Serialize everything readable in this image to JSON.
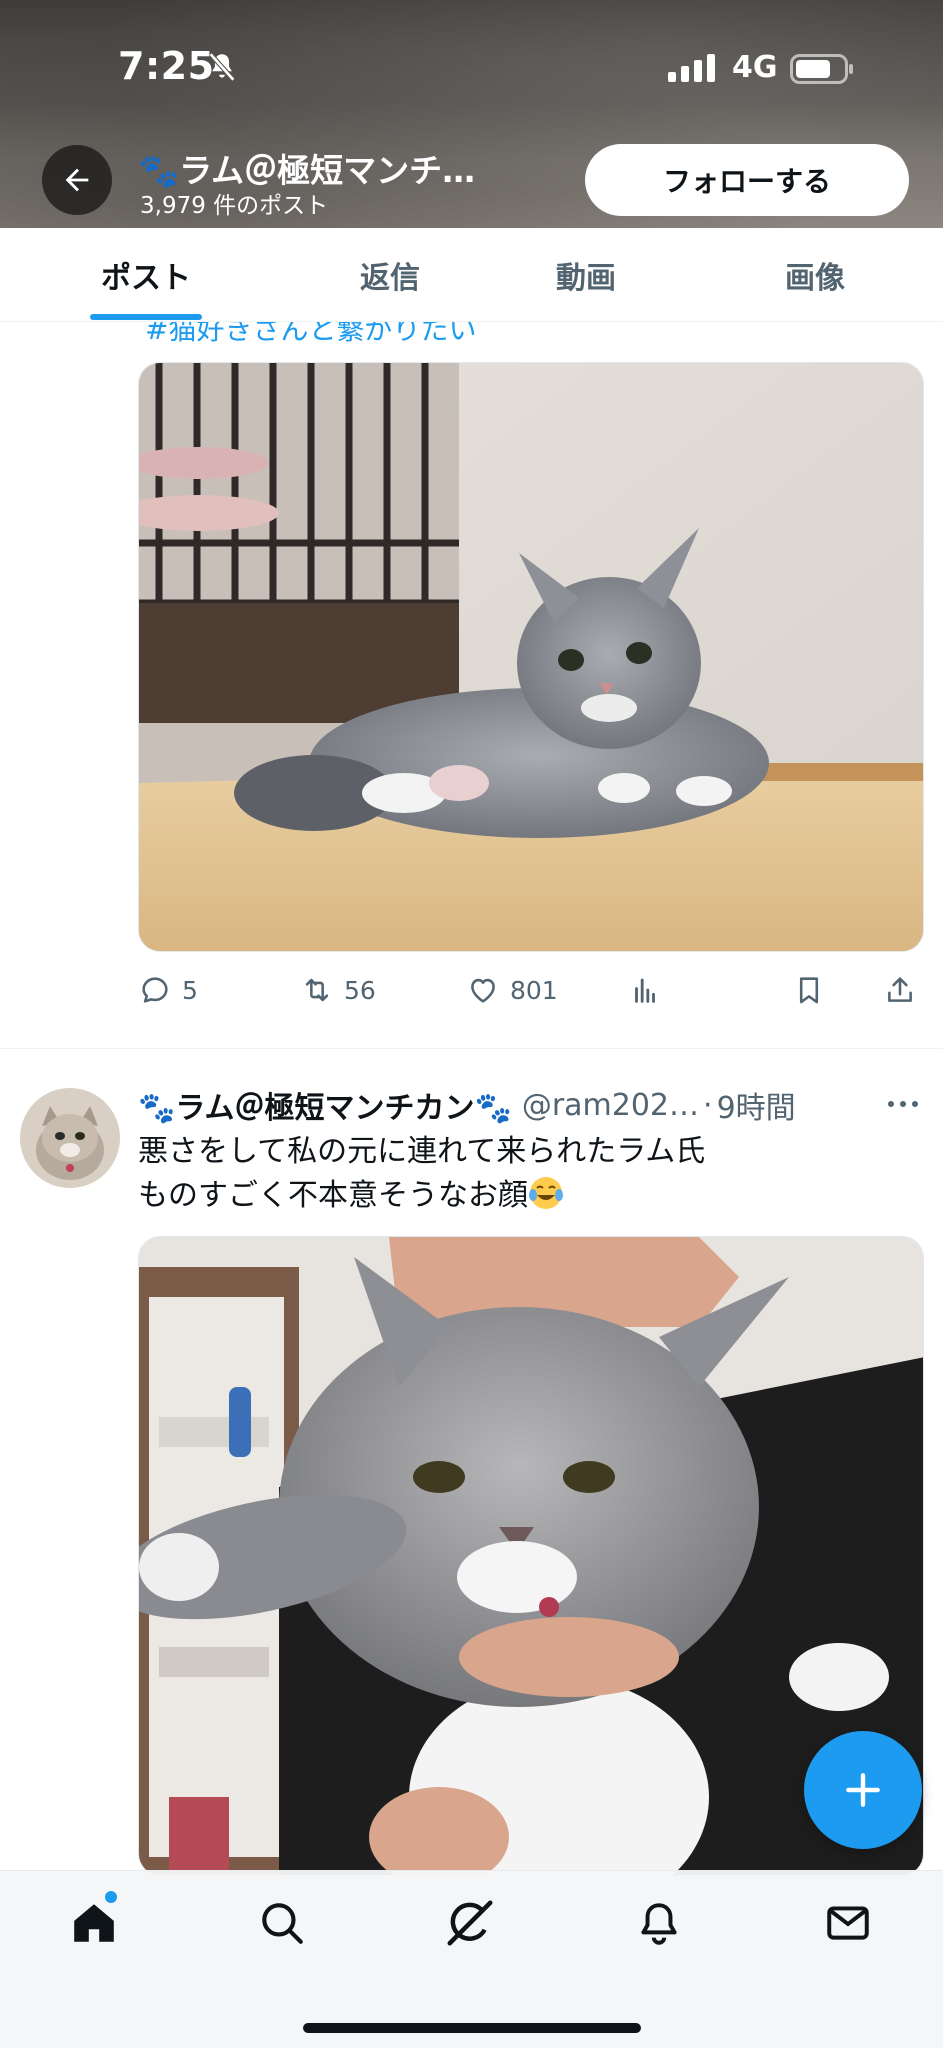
{
  "status_bar": {
    "time": "7:25",
    "network": "4G"
  },
  "profile_header": {
    "name": "🐾ラム＠極短マンチ…",
    "post_count": "3,979 件のポスト",
    "follow_label": "フォローする"
  },
  "tabs": [
    {
      "label": "ポスト",
      "active": true
    },
    {
      "label": "返信",
      "active": false
    },
    {
      "label": "動画",
      "active": false
    },
    {
      "label": "画像",
      "active": false
    }
  ],
  "post1": {
    "hashtag_partial": "#猫好きさんと繋がりたい",
    "replies": "5",
    "reposts": "56",
    "likes": "801"
  },
  "post2": {
    "author_name": "🐾ラム＠極短マンチカン🐾",
    "handle": "@ram202…",
    "dot": "·",
    "time": "9時間",
    "text_line1": "悪さをして私の元に連れて来られたラム氏",
    "text_line2": "ものすごく不本意そうなお顔"
  },
  "colors": {
    "accent": "#1d9bf0",
    "text": "#0f1419",
    "muted": "#536471"
  },
  "icons": {
    "back": "arrow-left-icon",
    "reply": "speech-bubble-icon",
    "repost": "repost-arrows-icon",
    "like": "heart-icon",
    "views": "bar-chart-icon",
    "bookmark": "bookmark-icon",
    "share": "share-upload-icon",
    "compose": "plus-icon",
    "nav": [
      "home-icon",
      "search-icon",
      "grok-icon",
      "bell-icon",
      "mail-icon"
    ]
  }
}
